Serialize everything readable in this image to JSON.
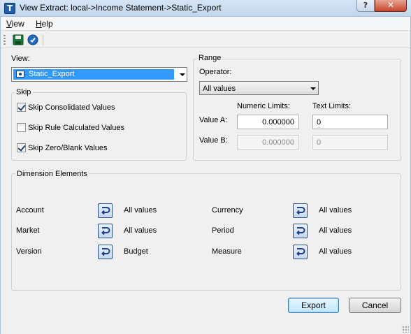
{
  "window": {
    "title": "View Extract:  local->Income Statement->Static_Export",
    "help_glyph": "?",
    "close_glyph": "✕"
  },
  "menu": {
    "view": "View",
    "help": "Help"
  },
  "toolbar": {
    "save_icon": "save-icon",
    "refresh_icon": "refresh-icon"
  },
  "view_section": {
    "label": "View:",
    "selected": "Static_Export"
  },
  "skip": {
    "title": "Skip",
    "options": [
      {
        "label": "Skip Consolidated Values",
        "checked": true
      },
      {
        "label": "Skip Rule Calculated Values",
        "checked": false
      },
      {
        "label": "Skip Zero/Blank Values",
        "checked": true
      }
    ]
  },
  "range": {
    "title": "Range",
    "operator_label": "Operator:",
    "operator_value": "All values",
    "numeric_header": "Numeric Limits:",
    "text_header": "Text Limits:",
    "value_a_label": "Value A:",
    "value_b_label": "Value B:",
    "value_a_numeric": "0.000000",
    "value_a_text": "0",
    "value_b_numeric": "0.000000",
    "value_b_text": "0"
  },
  "dimensions": {
    "title": "Dimension Elements",
    "items": [
      {
        "name": "Account",
        "value": "All values"
      },
      {
        "name": "Currency",
        "value": "All values"
      },
      {
        "name": "Market",
        "value": "All values"
      },
      {
        "name": "Period",
        "value": "All values"
      },
      {
        "name": "Version",
        "value": "Budget"
      },
      {
        "name": "Measure",
        "value": "All values"
      }
    ]
  },
  "buttons": {
    "export": "Export",
    "cancel": "Cancel"
  },
  "colors": {
    "selection": "#3399ff",
    "window_bg": "#f0f0f0",
    "titlebar": "#c9dcef",
    "close": "#c7452c"
  }
}
